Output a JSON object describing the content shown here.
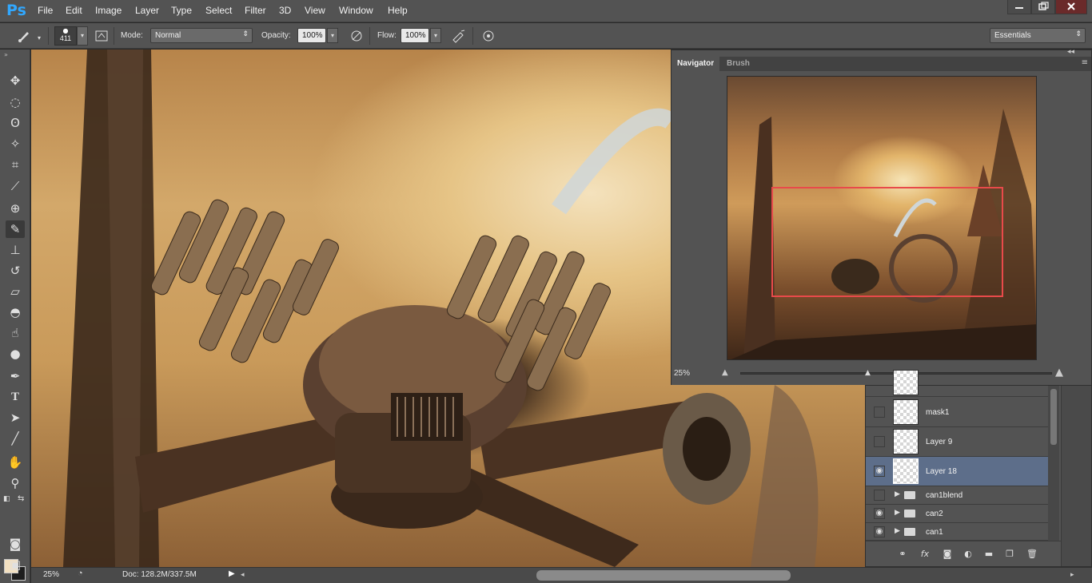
{
  "app": {
    "logo": "Ps"
  },
  "menu": [
    "File",
    "Edit",
    "Image",
    "Layer",
    "Type",
    "Select",
    "Filter",
    "3D",
    "View",
    "Window",
    "Help"
  ],
  "options": {
    "brush_size": "411",
    "mode_label": "Mode:",
    "mode_value": "Normal",
    "opacity_label": "Opacity:",
    "opacity_value": "100%",
    "flow_label": "Flow:",
    "flow_value": "100%",
    "workspace": "Essentials"
  },
  "navigator": {
    "tabs": [
      "Navigator",
      "Brush"
    ],
    "zoom": "25%"
  },
  "layers": {
    "rows": [
      {
        "name": "mask1",
        "visible": false,
        "type": "layer"
      },
      {
        "name": "Layer 9",
        "visible": false,
        "type": "layer"
      },
      {
        "name": "Layer 18",
        "visible": true,
        "type": "layer",
        "selected": true
      },
      {
        "name": "can1blend",
        "visible": false,
        "type": "group"
      },
      {
        "name": "can2",
        "visible": true,
        "type": "group"
      },
      {
        "name": "can1",
        "visible": true,
        "type": "group"
      }
    ]
  },
  "status": {
    "zoom": "25%",
    "doc": "Doc: 128.2M/337.5M"
  },
  "colors": {
    "foreground": "#f3e0c0",
    "background": "#1e1e1e",
    "accent_selected": "#5d6e8a",
    "nav_viewbox": "#e84a4a"
  }
}
